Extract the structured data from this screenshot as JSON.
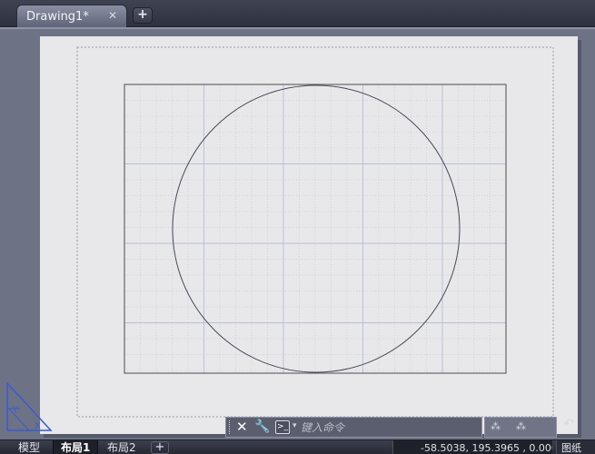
{
  "tabs": {
    "document_title": "Drawing1*",
    "close_symbol": "✕",
    "new_tab_symbol": "+"
  },
  "command_line": {
    "close_symbol": "✕",
    "customize_symbol": "🔧",
    "prompt_symbol": ">_",
    "dropdown_symbol": "▾",
    "placeholder": "键入命令"
  },
  "layout_tabs": [
    {
      "label": "模型",
      "active": false
    },
    {
      "label": "布局1",
      "active": true
    },
    {
      "label": "布局2",
      "active": false
    }
  ],
  "add_layout_symbol": "+",
  "status": {
    "coordinates": "-58.5038, 195.3965 , 0.0000",
    "space_mode": "图纸"
  },
  "ucs": {
    "y_label": "Y",
    "x_label": "X"
  },
  "colors": {
    "paper": "#e8e8ea",
    "grid_line": "#b9bdd6",
    "viewport_border": "#4a4a52",
    "circle": "#4a4a5a",
    "ucs": "#3a5bd0"
  }
}
